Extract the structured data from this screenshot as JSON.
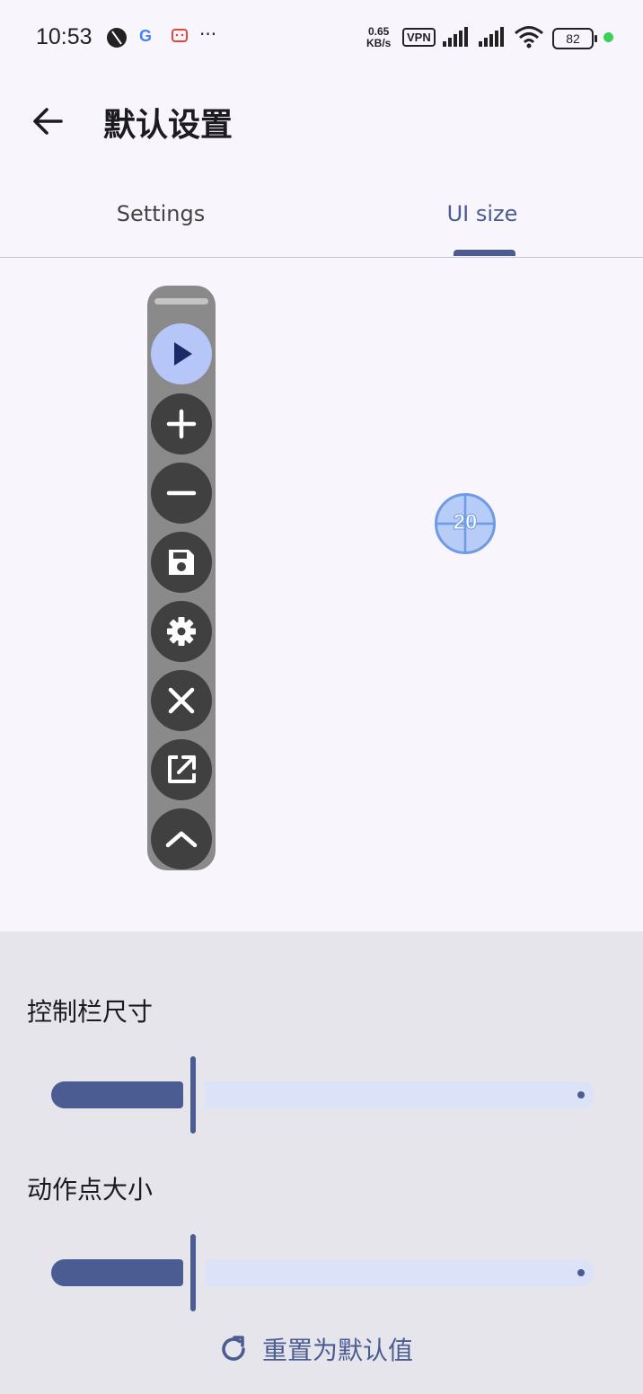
{
  "status": {
    "time": "10:53",
    "net_speed_value": "0.65",
    "net_speed_unit": "KB/s",
    "vpn": "VPN",
    "battery": "82",
    "more": "···"
  },
  "appbar": {
    "title": "默认设置"
  },
  "tabs": [
    {
      "label": "Settings",
      "active": false
    },
    {
      "label": "UI size",
      "active": true
    }
  ],
  "toolbar": {
    "buttons": [
      "play-icon",
      "plus-icon",
      "minus-icon",
      "save-icon",
      "gear-icon",
      "close-icon",
      "open-external-icon",
      "chevron-up-icon"
    ]
  },
  "action_point": {
    "label": "20"
  },
  "settings": {
    "control_bar_size_label": "控制栏尺寸",
    "control_bar_size_value": 0.25,
    "action_point_size_label": "动作点大小",
    "action_point_size_value": 0.25,
    "reset_label": "重置为默认值"
  },
  "colors": {
    "accent": "#4a5c92",
    "background": "#f8f6fc",
    "panel": "#e6e5ec",
    "slider_track_inactive": "#dce2f8"
  }
}
